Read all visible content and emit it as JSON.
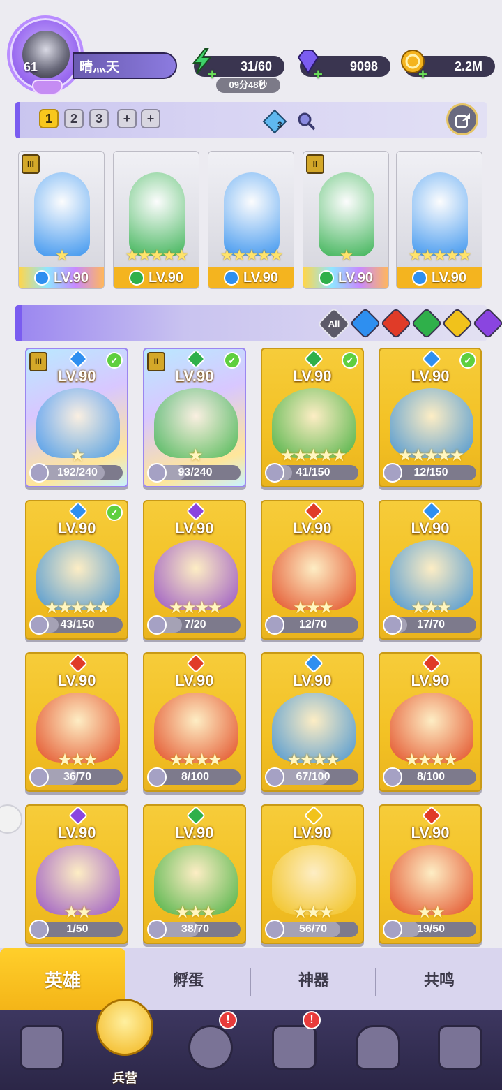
{
  "player": {
    "level": "61",
    "name": "晴灬天"
  },
  "resources": {
    "energy": {
      "icon": "lightning-icon",
      "value": "31/60",
      "timer": "09分48秒",
      "color": "#3fd26a"
    },
    "gems": {
      "icon": "diamond-icon",
      "value": "9098",
      "color": "#7b5cf0"
    },
    "gold": {
      "icon": "coin-icon",
      "value": "2.2M",
      "color": "#f4b41f"
    }
  },
  "team": {
    "tabs": [
      "1",
      "2",
      "3",
      "+",
      "+"
    ],
    "active_tab": "1",
    "scroll_count": "3",
    "heroes": [
      {
        "level": "LV.90",
        "element": "water",
        "color": "#2e8ff0",
        "rank": "III",
        "stars": "★",
        "rainbow": true
      },
      {
        "level": "LV.90",
        "element": "wind",
        "color": "#2fb04a",
        "rank": "",
        "stars": "★★★★★",
        "rainbow": false
      },
      {
        "level": "LV.90",
        "element": "water",
        "color": "#2e8ff0",
        "rank": "",
        "stars": "★★★★★",
        "rainbow": false
      },
      {
        "level": "LV.90",
        "element": "wind",
        "color": "#2fb04a",
        "rank": "II",
        "stars": "★",
        "rainbow": true
      },
      {
        "level": "LV.90",
        "element": "water",
        "color": "#2e8ff0",
        "rank": "",
        "stars": "★★★★★",
        "rainbow": false
      }
    ]
  },
  "filters": {
    "all_label": "All",
    "elements": [
      {
        "name": "water",
        "color": "#2e8ff0"
      },
      {
        "name": "fire",
        "color": "#e03b28"
      },
      {
        "name": "wind",
        "color": "#2fb04a"
      },
      {
        "name": "light",
        "color": "#f1c21b"
      },
      {
        "name": "dark",
        "color": "#8a45e0"
      }
    ]
  },
  "heroes": [
    {
      "level": "LV.90",
      "element": "#2e8ff0",
      "progress": "192/240",
      "ratio": 0.8,
      "stars": "★",
      "check": true,
      "rank": "III",
      "rainbow": true
    },
    {
      "level": "LV.90",
      "element": "#2fb04a",
      "progress": "93/240",
      "ratio": 0.39,
      "stars": "★",
      "check": true,
      "rank": "II",
      "rainbow": true
    },
    {
      "level": "LV.90",
      "element": "#2fb04a",
      "progress": "41/150",
      "ratio": 0.27,
      "stars": "★★★★★",
      "check": true,
      "rank": "",
      "rainbow": false
    },
    {
      "level": "LV.90",
      "element": "#2e8ff0",
      "progress": "12/150",
      "ratio": 0.08,
      "stars": "★★★★★",
      "check": true,
      "rank": "",
      "rainbow": false
    },
    {
      "level": "LV.90",
      "element": "#2e8ff0",
      "progress": "43/150",
      "ratio": 0.29,
      "stars": "★★★★★",
      "check": true,
      "rank": "",
      "rainbow": false
    },
    {
      "level": "LV.90",
      "element": "#8a45e0",
      "progress": "7/20",
      "ratio": 0.35,
      "stars": "★★★★",
      "check": false,
      "rank": "",
      "rainbow": false
    },
    {
      "level": "LV.90",
      "element": "#e03b28",
      "progress": "12/70",
      "ratio": 0.17,
      "stars": "★★★",
      "check": false,
      "rank": "",
      "rainbow": false
    },
    {
      "level": "LV.90",
      "element": "#2e8ff0",
      "progress": "17/70",
      "ratio": 0.24,
      "stars": "★★★",
      "check": false,
      "rank": "",
      "rainbow": false
    },
    {
      "level": "LV.90",
      "element": "#e03b28",
      "progress": "36/70",
      "ratio": 0.51,
      "stars": "★★★",
      "check": false,
      "rank": "",
      "rainbow": false
    },
    {
      "level": "LV.90",
      "element": "#e03b28",
      "progress": "8/100",
      "ratio": 0.08,
      "stars": "★★★★",
      "check": false,
      "rank": "",
      "rainbow": false
    },
    {
      "level": "LV.90",
      "element": "#2e8ff0",
      "progress": "67/100",
      "ratio": 0.67,
      "stars": "★★★★",
      "check": false,
      "rank": "",
      "rainbow": false
    },
    {
      "level": "LV.90",
      "element": "#e03b28",
      "progress": "8/100",
      "ratio": 0.08,
      "stars": "★★★★",
      "check": false,
      "rank": "",
      "rainbow": false
    },
    {
      "level": "LV.90",
      "element": "#8a45e0",
      "progress": "1/50",
      "ratio": 0.02,
      "stars": "★★",
      "check": false,
      "rank": "",
      "rainbow": false
    },
    {
      "level": "LV.90",
      "element": "#2fb04a",
      "progress": "38/70",
      "ratio": 0.54,
      "stars": "★★★",
      "check": false,
      "rank": "",
      "rainbow": false
    },
    {
      "level": "LV.90",
      "element": "#f1c21b",
      "progress": "56/70",
      "ratio": 0.8,
      "stars": "★★★",
      "check": false,
      "rank": "",
      "rainbow": false
    },
    {
      "level": "LV.90",
      "element": "#e03b28",
      "progress": "19/50",
      "ratio": 0.38,
      "stars": "★★",
      "check": false,
      "rank": "",
      "rainbow": false
    }
  ],
  "subtabs": [
    "英雄",
    "孵蛋",
    "神器",
    "共鸣"
  ],
  "nav": {
    "items": [
      {
        "icon": "cards-icon",
        "label": "",
        "alert": false
      },
      {
        "icon": "barracks-icon",
        "label": "兵营",
        "alert": false,
        "active": true
      },
      {
        "icon": "map-icon",
        "label": "",
        "alert": true
      },
      {
        "icon": "castle-icon",
        "label": "",
        "alert": true
      },
      {
        "icon": "mushroom-icon",
        "label": "",
        "alert": false
      },
      {
        "icon": "guild-icon",
        "label": "",
        "alert": false
      }
    ],
    "alert_mark": "!"
  }
}
